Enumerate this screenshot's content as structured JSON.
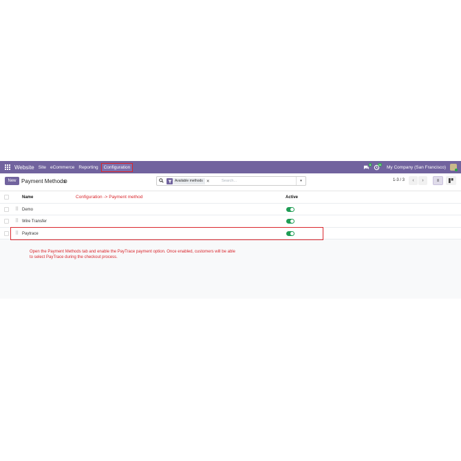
{
  "navbar": {
    "brand": "Website",
    "menu": [
      "Site",
      "eCommerce",
      "Reporting"
    ],
    "active_menu": "Configuration",
    "chat_badge": "5",
    "activity_badge": "20",
    "company": "My Company (San Francisco)",
    "colors": {
      "bar": "#71639e"
    }
  },
  "control": {
    "new_label": "New",
    "title": "Payment Methods",
    "search": {
      "facet": "Available methods",
      "placeholder": "Search..."
    },
    "pager": "1-3 / 3"
  },
  "list": {
    "headers": {
      "name": "Name",
      "active": "Active"
    },
    "rows": [
      {
        "name": "Demo",
        "active": true
      },
      {
        "name": "Wire Transfer",
        "active": true
      },
      {
        "name": "Paytrace",
        "active": true
      }
    ]
  },
  "annotations": {
    "path": "Configuration -> Payment method",
    "note_line1": "Open the Payment Methods tab and enable the PayTrace payment option. Once enabled, customers will be able",
    "note_line2": "to select PayTrace during the checkout process.",
    "color": "#d9252b"
  },
  "icons": [
    "apps-icon",
    "chat-icon",
    "activity-icon",
    "gear-icon",
    "search-icon",
    "filter-icon",
    "list-view-icon",
    "kanban-view-icon",
    "drag-handle-icon"
  ]
}
